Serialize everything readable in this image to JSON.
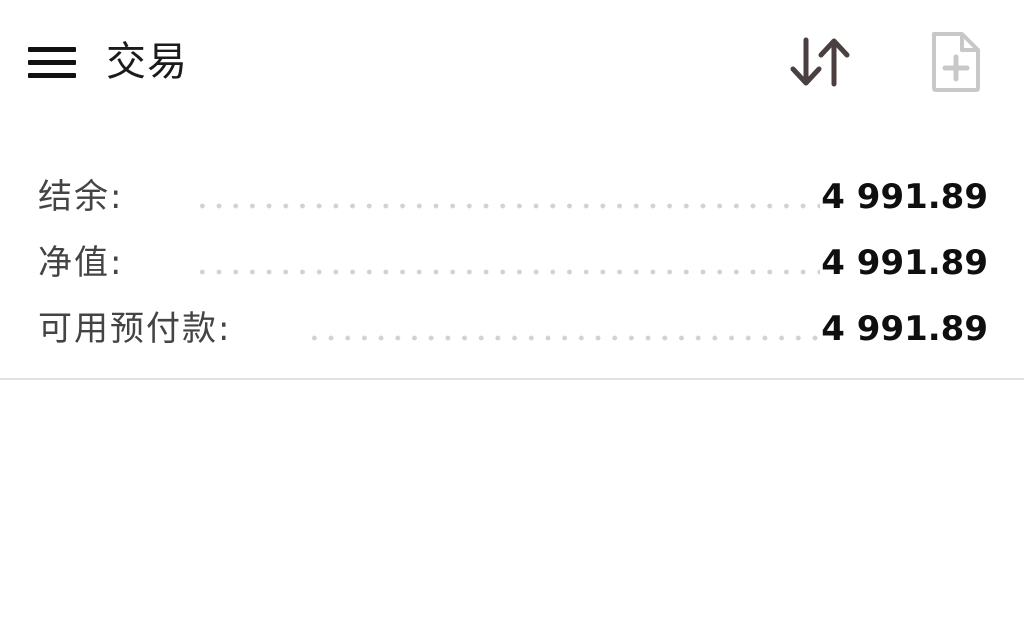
{
  "header": {
    "title": "交易",
    "menu_icon": "hamburger-menu-icon",
    "sort_icon": "sort-arrows-icon",
    "new_order_icon": "new-document-plus-icon",
    "icon_color": "#4a4040",
    "disabled_icon_color": "#c8c8c8"
  },
  "summary": {
    "rows": [
      {
        "label": "结余:",
        "value": "4 991.89"
      },
      {
        "label": "净值:",
        "value": "4 991.89"
      },
      {
        "label": "可用预付款:",
        "value": "4 991.89"
      }
    ]
  }
}
